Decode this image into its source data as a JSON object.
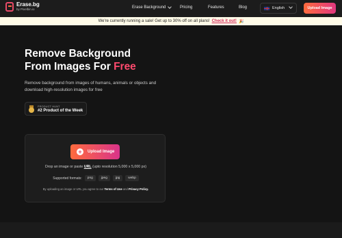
{
  "header": {
    "logo_name": "Erase.bg",
    "logo_by": "by Pixelbin.io",
    "nav": [
      "Erase Background",
      "Pricing",
      "Features",
      "Blog"
    ],
    "language": "English",
    "upload_label": "Upload Image"
  },
  "banner": {
    "text": "We're currently running a sale! Get up to 30% off on all plans!",
    "link": "Check it out!",
    "emoji": "🎉"
  },
  "hero": {
    "line1": "Remove Background",
    "line2": "From Images For ",
    "highlight": "Free",
    "subtext": "Remove background from images of humans, animals or objects and download high-resolution images for free"
  },
  "badge": {
    "small": "PRODUCT HUNT",
    "big": "#2 Product of the Week"
  },
  "upload_card": {
    "button": "Upload Image",
    "drop_pre": "Drop an image or paste ",
    "drop_link": "URL",
    "drop_post": " (upto resolution 5,000 x 5,000 px)",
    "formats_label": "Supported formats:",
    "formats": [
      "png",
      "jpeg",
      "jpg",
      "webp"
    ],
    "terms_pre": "By uploading an image or URL you agree to our ",
    "terms_link1": "Terms of Use",
    "terms_mid": " and ",
    "terms_link2": "Privacy Policy."
  },
  "colors": {
    "accent_start": "#ff6b3d",
    "accent_end": "#d9338a",
    "highlight": "#ff4a6e",
    "background": "#141414"
  }
}
